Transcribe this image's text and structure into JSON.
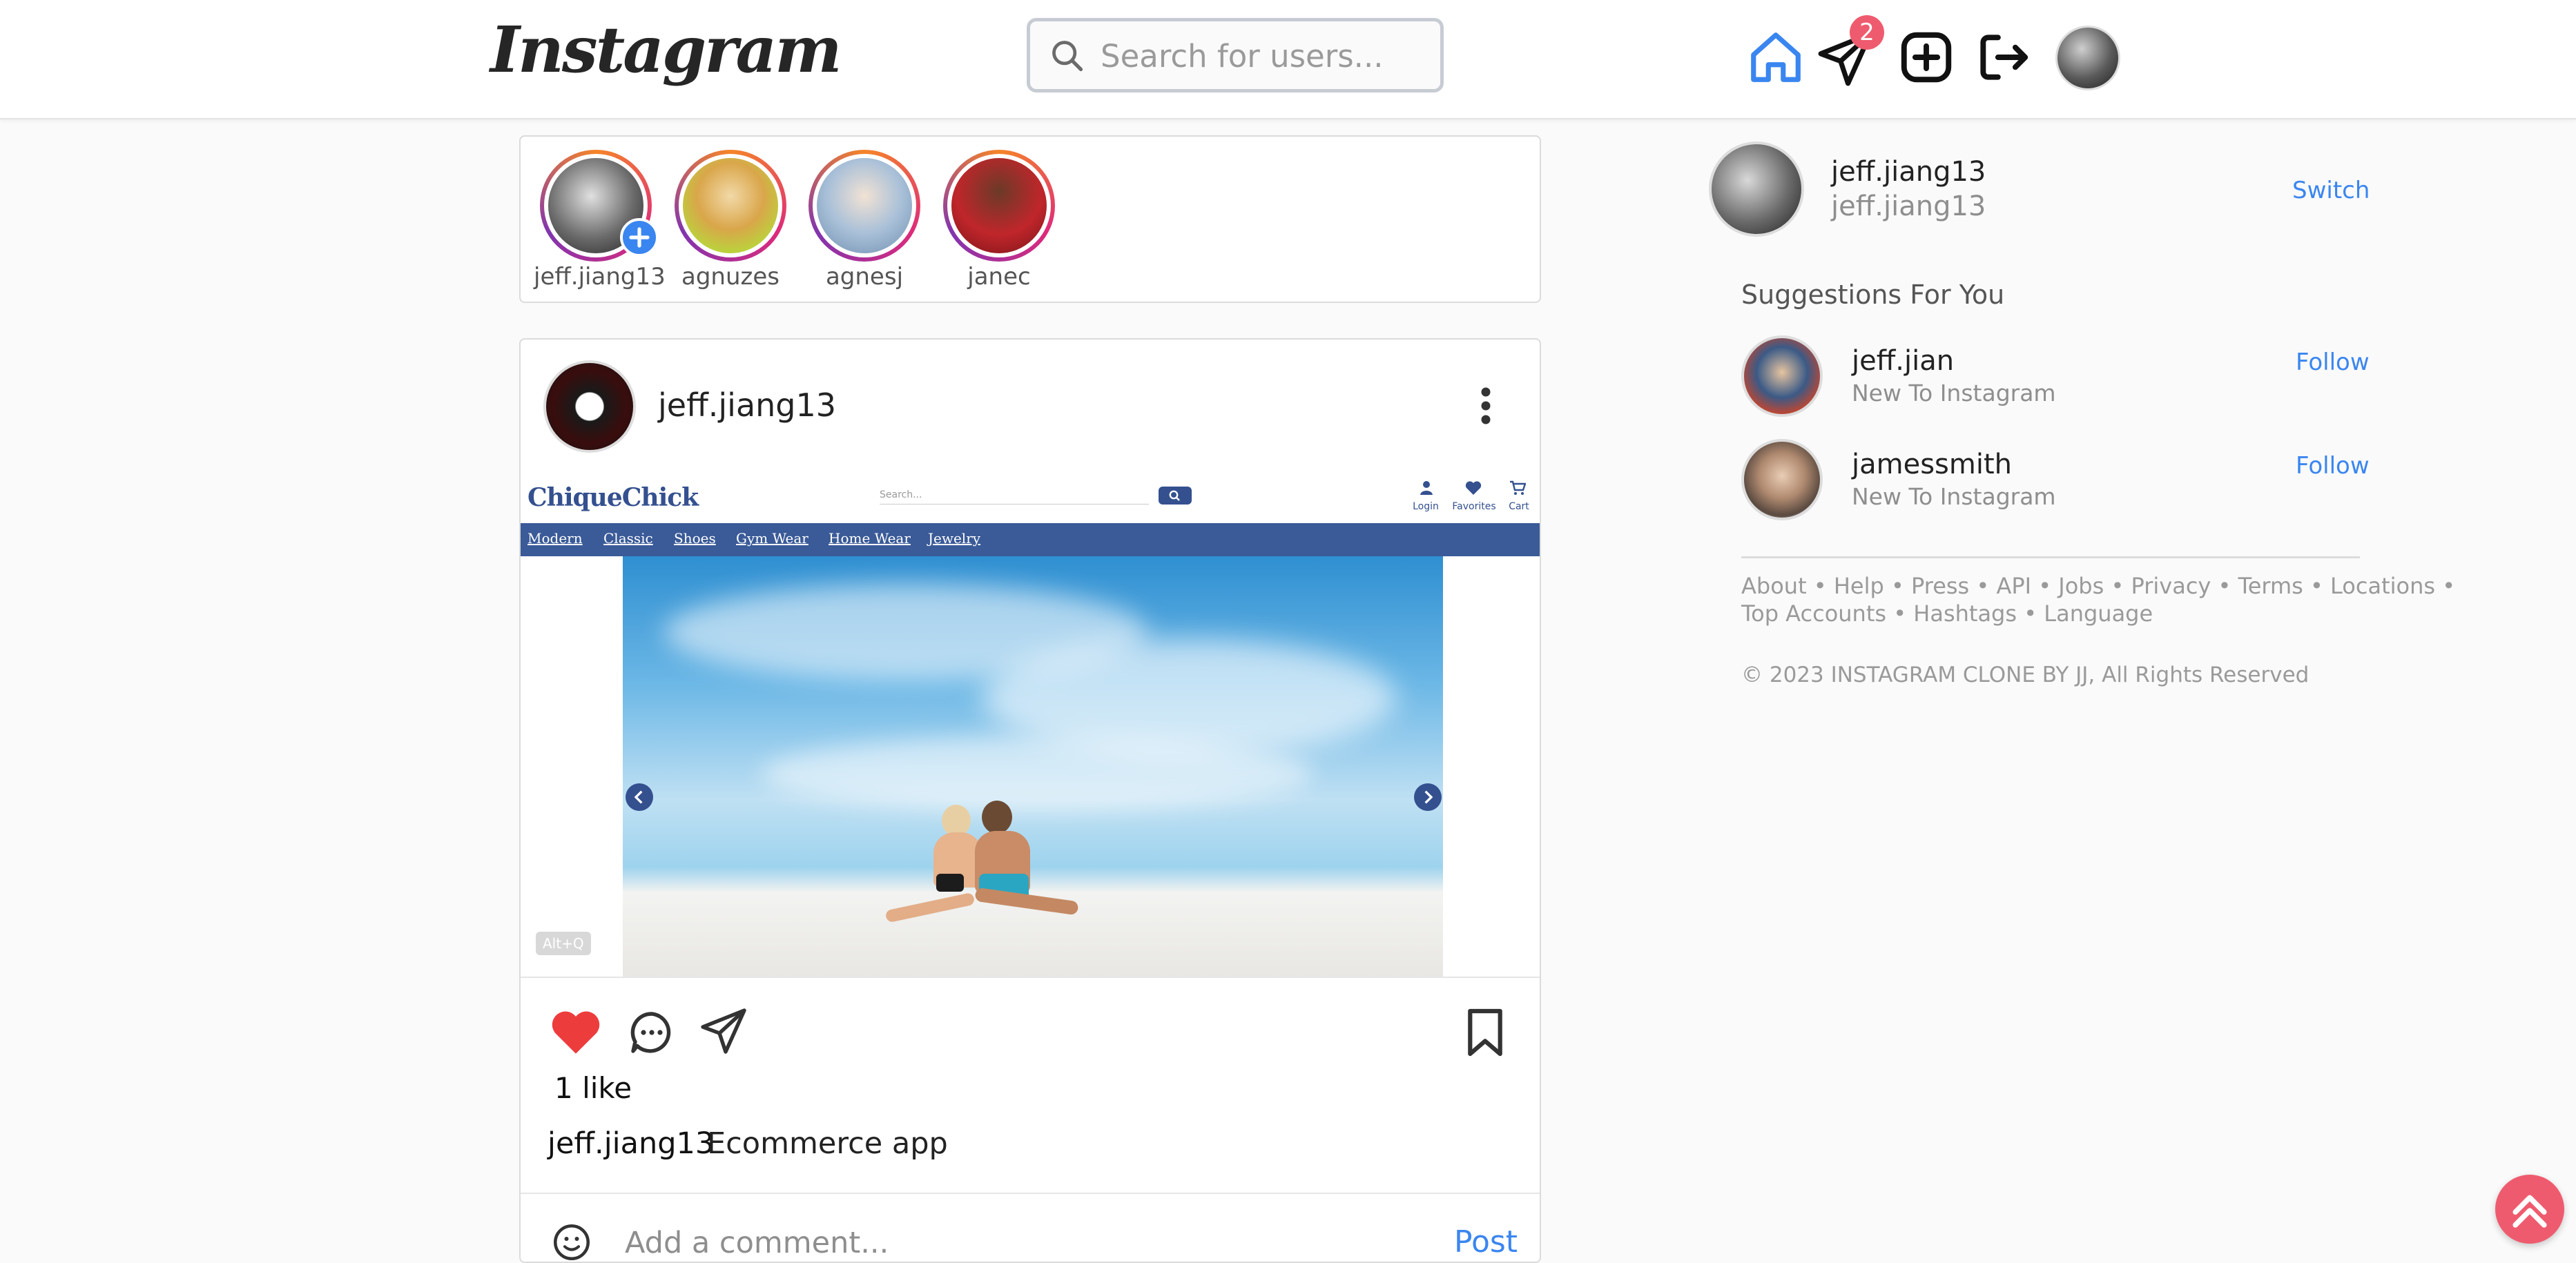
{
  "header": {
    "logo": "Instagram",
    "search_placeholder": "Search for users...",
    "messages_badge": "2"
  },
  "stories": [
    {
      "username": "jeff.jiang13",
      "has_add": true
    },
    {
      "username": "agnuzes",
      "has_add": false
    },
    {
      "username": "agnesj",
      "has_add": false
    },
    {
      "username": "janec",
      "has_add": false
    }
  ],
  "post": {
    "author": "jeff.jiang13",
    "shop": {
      "brand": "ChiqueChick",
      "search_placeholder": "Search...",
      "icons": [
        {
          "label": "Login",
          "icon": "user-icon"
        },
        {
          "label": "Favorites",
          "icon": "heart-icon"
        },
        {
          "label": "Cart",
          "icon": "cart-icon"
        }
      ],
      "nav": [
        "Modern",
        "Classic",
        "Shoes",
        "Gym Wear",
        "Home Wear",
        "Jewelry"
      ],
      "shortcut": "Alt+Q"
    },
    "likes": "1 like",
    "caption_user": "jeff.jiang13",
    "caption_text": "Ecommerce app",
    "comment_placeholder": "Add a comment...",
    "post_button": "Post"
  },
  "sidebar": {
    "username": "jeff.jiang13",
    "subname": "jeff.jiang13",
    "switch_label": "Switch",
    "suggestions_title": "Suggestions For You",
    "suggestions": [
      {
        "username": "jeff.jian",
        "subtitle": "New To Instagram",
        "action": "Follow"
      },
      {
        "username": "jamessmith",
        "subtitle": "New To Instagram",
        "action": "Follow"
      }
    ],
    "footer_links_line1": "About • Help • Press • API • Jobs • Privacy • Terms • Locations •",
    "footer_links_line2": "Top Accounts • Hashtags • Language",
    "copyright": "© 2023 INSTAGRAM CLONE BY JJ, All Rights Reserved"
  },
  "colors": {
    "accent": "#3a86f0",
    "like": "#ed3c3c",
    "badge": "#ef5b6e",
    "shop_nav": "#3a5a98"
  }
}
